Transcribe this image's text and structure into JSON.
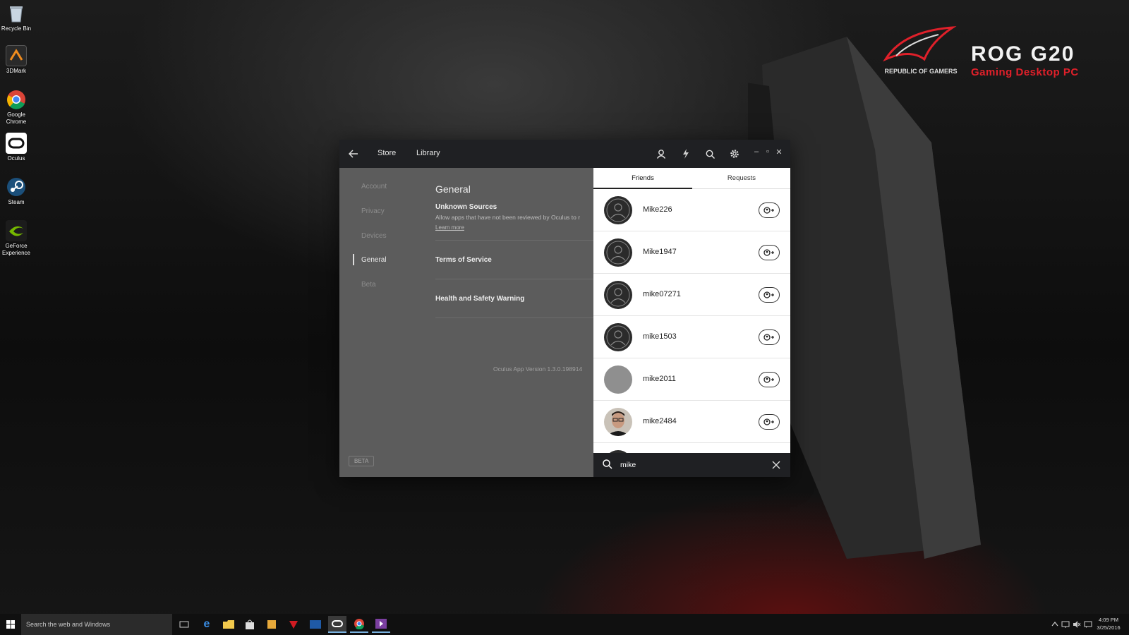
{
  "wallpaper": {
    "brand_emblem_text": "REPUBLIC OF GAMERS",
    "brand_title": "ROG G20",
    "brand_subtitle": "Gaming Desktop PC",
    "accent_color": "#e0202a"
  },
  "desktop": {
    "icons": [
      {
        "label": "Recycle Bin",
        "icon": "recycle-bin-icon"
      },
      {
        "label": "3DMark",
        "icon": "3dmark-icon"
      },
      {
        "label": "Google Chrome",
        "icon": "chrome-icon"
      },
      {
        "label": "Oculus",
        "icon": "oculus-icon"
      },
      {
        "label": "Steam",
        "icon": "steam-icon"
      },
      {
        "label": "GeForce Experience",
        "icon": "geforce-icon"
      }
    ]
  },
  "oculus": {
    "titlebar": {
      "store_label": "Store",
      "library_label": "Library",
      "icons": [
        "back-arrow-icon",
        "profile-icon",
        "notifications-bolt-icon",
        "search-icon",
        "settings-gear-icon"
      ]
    },
    "settings": {
      "sidebar": [
        {
          "label": "Account",
          "active": false
        },
        {
          "label": "Privacy",
          "active": false
        },
        {
          "label": "Devices",
          "active": false
        },
        {
          "label": "General",
          "active": true
        },
        {
          "label": "Beta",
          "active": false
        }
      ],
      "heading": "General",
      "unknown_sources_title": "Unknown Sources",
      "unknown_sources_desc": "Allow apps that have not been reviewed by Oculus to r",
      "learn_more": "Learn more",
      "terms_of_service": "Terms of Service",
      "health_safety": "Health and Safety Warning",
      "version": "Oculus App Version 1.3.0.198914",
      "beta_badge": "BETA"
    },
    "friends": {
      "tabs": [
        {
          "label": "Friends",
          "active": true
        },
        {
          "label": "Requests",
          "active": false
        }
      ],
      "results": [
        {
          "name": "Mike226",
          "avatar": "default"
        },
        {
          "name": "Mike1947",
          "avatar": "default"
        },
        {
          "name": "mike07271",
          "avatar": "default"
        },
        {
          "name": "mike1503",
          "avatar": "default"
        },
        {
          "name": "mike2011",
          "avatar": "gray"
        },
        {
          "name": "mike2484",
          "avatar": "photo"
        }
      ],
      "search_value": "mike"
    }
  },
  "taskbar": {
    "search_placeholder": "Search the web and Windows",
    "apps": [
      "task-view-icon",
      "edge-icon",
      "file-explorer-icon",
      "store-icon",
      "folder-icon",
      "asus-rog-icon",
      "asus-icon",
      "oculus-icon",
      "chrome-icon",
      "media-player-icon"
    ],
    "clock_time": "4:09 PM",
    "clock_date": "3/25/2016"
  }
}
